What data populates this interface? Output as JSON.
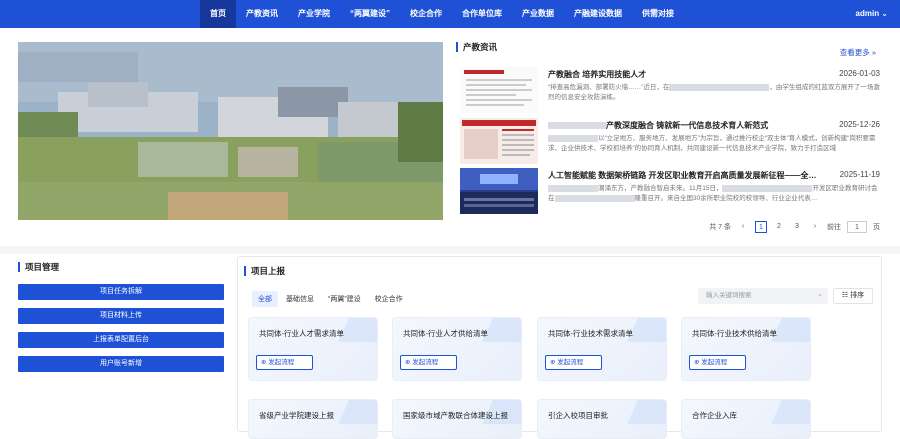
{
  "nav": {
    "items": [
      "首页",
      "产教资讯",
      "产业学院",
      "“两翼建设”",
      "校企合作",
      "合作单位库",
      "产业数据",
      "产融建设数据",
      "供需对接"
    ],
    "active_index": 0,
    "user": "admin ⌄"
  },
  "news": {
    "title": "产教资讯",
    "more": "查看更多 »",
    "items": [
      {
        "title": "产教融合 培养实用技能人才",
        "date": "2026-01-03",
        "summary_a": "“排查高危漏洞、部署防火墙……”近日，在",
        "summary_b": "，由学生组成的红蓝双方展开了一场激烈的信息安全攻防演练。"
      },
      {
        "title": "产教深度融合 铸就新一代信息技术育人新范式",
        "date": "2025-12-26",
        "summary_a": "以“立足地方、服务地方、发展地方”为宗旨，通过推行校企“双主体”育人模式，创新构建“岗",
        "summary_b": "积要需求、企业供技术、学校抓培养”的协同育人机制，共同建设新一代信息技术产业学院，致力于打造区域"
      },
      {
        "title": "人工智能赋能 数据架桥链路 开发区职业教育开启高质量发展新征程——全国开…",
        "date": "2025-11-19",
        "summary_a": "潮涌东方，产教融合智启未来。11月15日，",
        "summary_b": "开发区职业教育研讨会在",
        "summary_c": "隆重召开。来自全国30余所职业院校的校领导、行业企业代表…"
      }
    ],
    "pager": {
      "total": "共 7 条",
      "prev": "‹",
      "pages": [
        "1",
        "2",
        "3"
      ],
      "current": "1",
      "next": "›",
      "goto": "前往",
      "goto_value": "1",
      "unit": "页"
    }
  },
  "left": {
    "title": "项目管理",
    "buttons": [
      "项目任务拆解",
      "项目材料上传",
      "上报表单配置后台",
      "用户账号新增"
    ]
  },
  "report": {
    "title": "项目上报",
    "tabs": [
      "全部",
      "基础信息",
      "“两翼”建设",
      "校企合作"
    ],
    "active_tab": 0,
    "search_placeholder": "输入关键词搜索",
    "sort": "排序",
    "cards": [
      {
        "title": "共同体-行业人才需求清单",
        "button": "发起流程"
      },
      {
        "title": "共同体-行业人才供给清单",
        "button": "发起流程"
      },
      {
        "title": "共同体-行业技术需求清单",
        "button": "发起流程"
      },
      {
        "title": "共同体-行业技术供给清单",
        "button": "发起流程"
      },
      {
        "title": "省级产业学院建设上报"
      },
      {
        "title": "国家级市域产教联合体建设上报"
      },
      {
        "title": "引企入校项目审批"
      },
      {
        "title": "合作企业入库"
      }
    ]
  }
}
